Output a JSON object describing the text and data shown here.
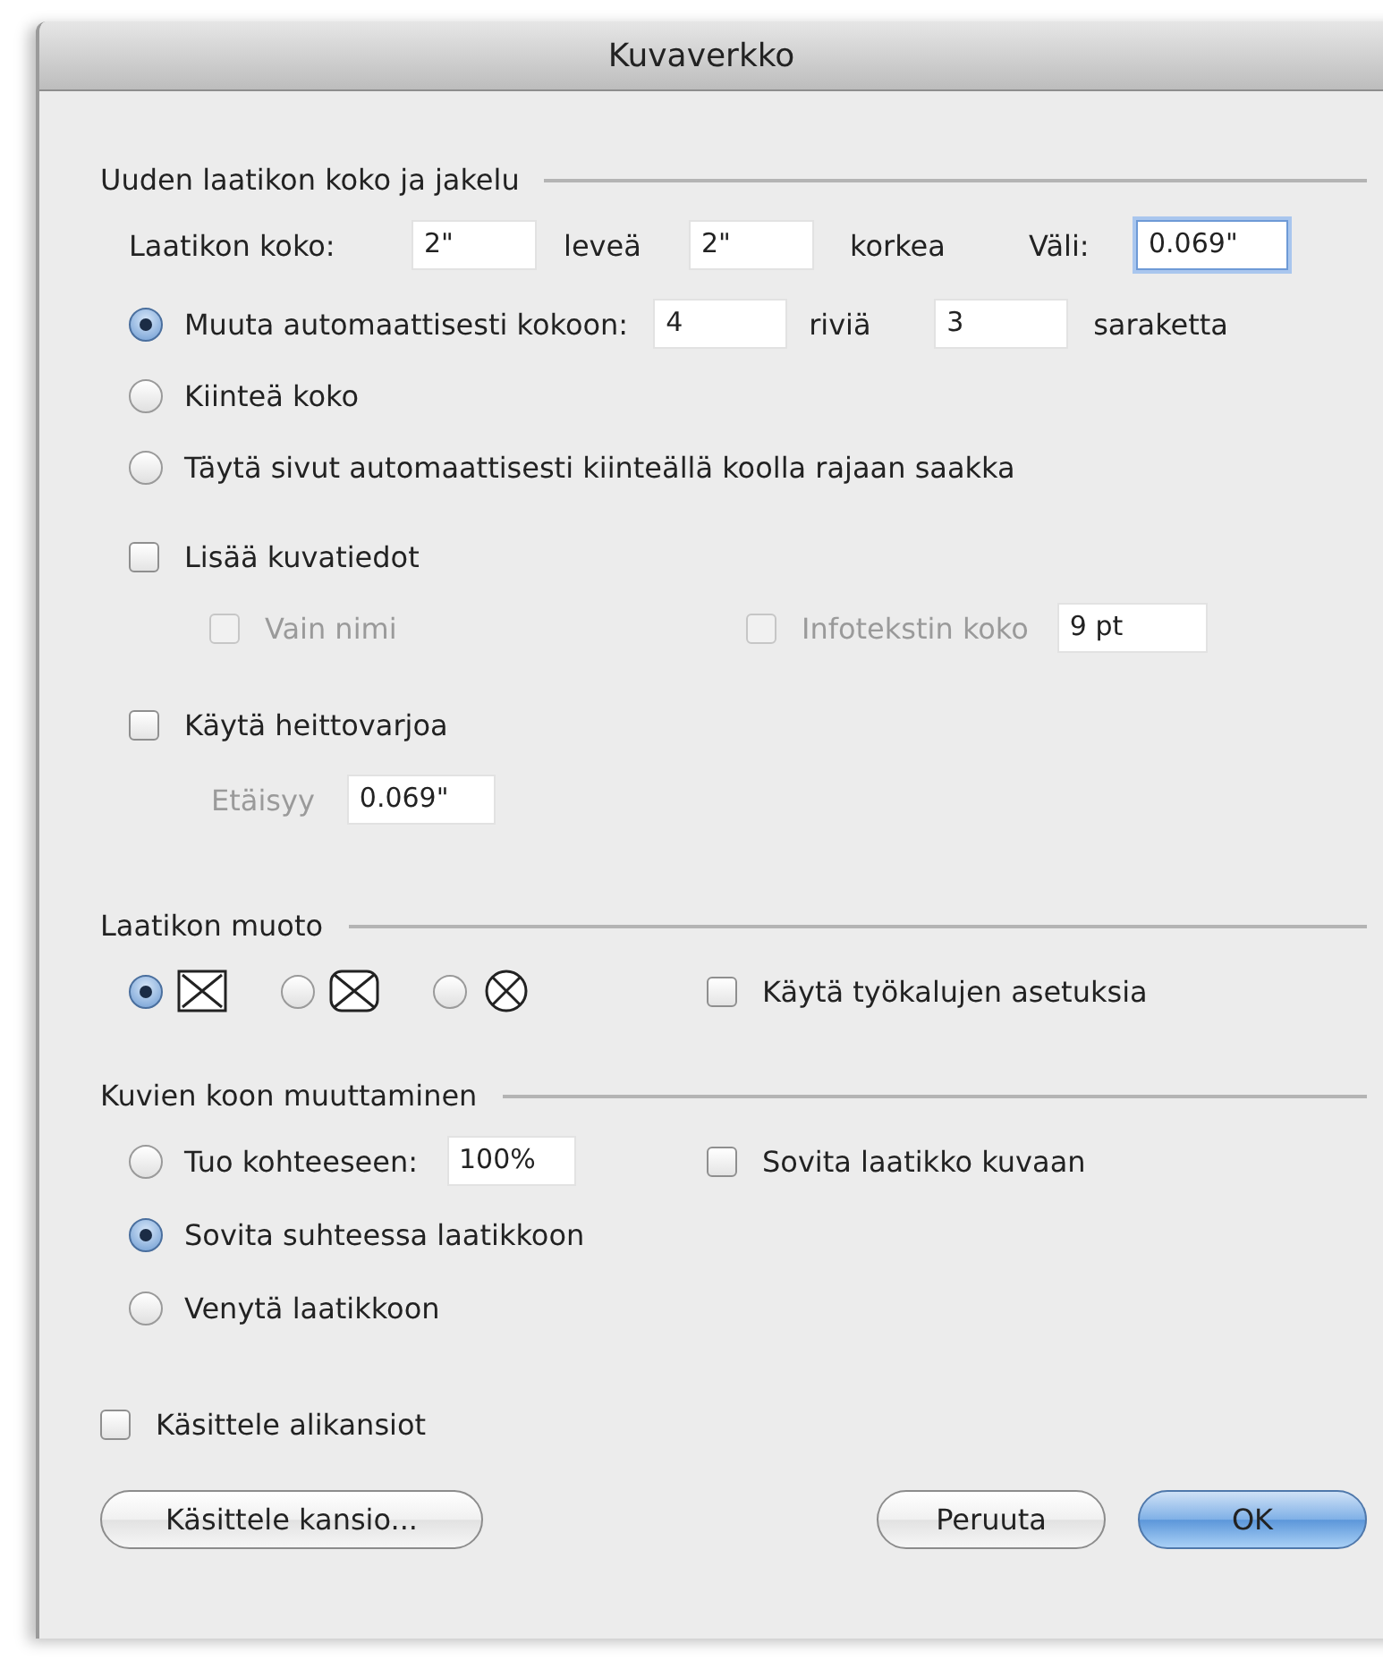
{
  "window": {
    "title": "Kuvaverkko"
  },
  "distribution": {
    "heading": "Uuden laatikon koko ja jakelu",
    "size_row": {
      "label": "Laatikon koko:",
      "width_value": "2\"",
      "width_label": "leveä",
      "height_value": "2\"",
      "height_label": "korkea",
      "spacing_label": "Väli:",
      "spacing_value": "0.069\"",
      "spacing_focused": true
    },
    "options": [
      {
        "kind": "grid",
        "label": "Muuta automaattisesti kokoon:",
        "selected": true,
        "rows_value": "4",
        "rows_label": "riviä",
        "columns_value": "3",
        "columns_label": "saraketta"
      },
      {
        "kind": "plain",
        "label": "Kiinteä koko",
        "selected": false
      },
      {
        "kind": "plain",
        "label": "Täytä sivut automaattisesti kiinteällä koolla rajaan saakka",
        "selected": false
      }
    ],
    "captions": {
      "label": "Lisää kuvatiedot",
      "checked": false,
      "name_only": {
        "label": "Vain nimi",
        "checked": false,
        "disabled": true
      },
      "info_size": {
        "label": "Infotekstin koko",
        "checked": false,
        "disabled": true,
        "value": "9 pt"
      }
    },
    "shadow": {
      "label": "Käytä heittovarjoa",
      "checked": false,
      "distance_label": "Etäisyy",
      "distance_value": "0.069\"",
      "disabled": true
    }
  },
  "box_shape": {
    "heading": "Laatikon muoto",
    "shapes": [
      {
        "kind": "rectangle",
        "selected": true
      },
      {
        "kind": "rounded",
        "selected": false
      },
      {
        "kind": "oval",
        "selected": false
      }
    ],
    "tool_settings": {
      "label": "Käytä työkalujen asetuksia",
      "checked": false
    }
  },
  "image_sizing": {
    "heading": "Kuvien koon muuttaminen",
    "options": [
      {
        "kind": "scale",
        "label": "Tuo kohteeseen:",
        "value": "100%",
        "selected": false
      },
      {
        "kind": "plain",
        "label": "Sovita suhteessa laatikkoon",
        "selected": true
      },
      {
        "kind": "plain",
        "label": "Venytä laatikkoon",
        "selected": false
      }
    ],
    "fit_box": {
      "label": "Sovita laatikko kuvaan",
      "checked": false
    }
  },
  "subfolders": {
    "label": "Käsittele alikansiot",
    "checked": false
  },
  "buttons": [
    {
      "kind": "normal",
      "label": "Käsittele kansio..."
    },
    {
      "kind": "normal",
      "label": "Peruuta"
    },
    {
      "kind": "default",
      "label": "OK"
    }
  ]
}
